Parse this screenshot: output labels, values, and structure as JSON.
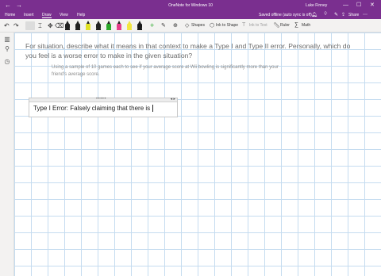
{
  "window": {
    "title": "OneNote for Windows 10",
    "user": "Luke Finney",
    "back_glyph": "←",
    "forward_glyph": "→",
    "min_glyph": "—",
    "max_glyph": "☐",
    "close_glyph": "✕"
  },
  "menu": {
    "tabs": [
      "Home",
      "Insert",
      "Draw",
      "View",
      "Help"
    ],
    "active_tab": "Draw",
    "sync_status": "Saved offline (auto sync is off)",
    "share_label": "Share"
  },
  "ribbon": {
    "shapes_label": "Shapes",
    "ink_to_shape_label": "Ink to Shape",
    "ink_to_text_label": "Ink to Text",
    "ruler_label": "Ruler",
    "math_label": "Math",
    "pens": [
      {
        "color": "#222222"
      },
      {
        "color": "#222222"
      },
      {
        "color": "#e0e024"
      },
      {
        "color": "#222222"
      },
      {
        "color": "#2aa82a"
      },
      {
        "color": "#e63d8a"
      },
      {
        "color": "#f2e640"
      },
      {
        "color": "#1a1a1a"
      }
    ]
  },
  "page": {
    "question": "For situation, describe what it means in that context to make a Type I and Type II error. Personally, which do you feel is a worse error to make in the given situation?",
    "context": "Using a sample of 10 games each to see if your average score at Wii bowling is significantly more than your friend's average score.",
    "note_text": "Type I Error: Falsely claiming that there is",
    "note_handle_dots": "•••••",
    "note_handle_arrows": "◂ ▸"
  },
  "colors": {
    "title_bar": "#7a2f8f",
    "ribbon_bg": "#f3f2f1",
    "grid_line": "#c5dcf0"
  }
}
